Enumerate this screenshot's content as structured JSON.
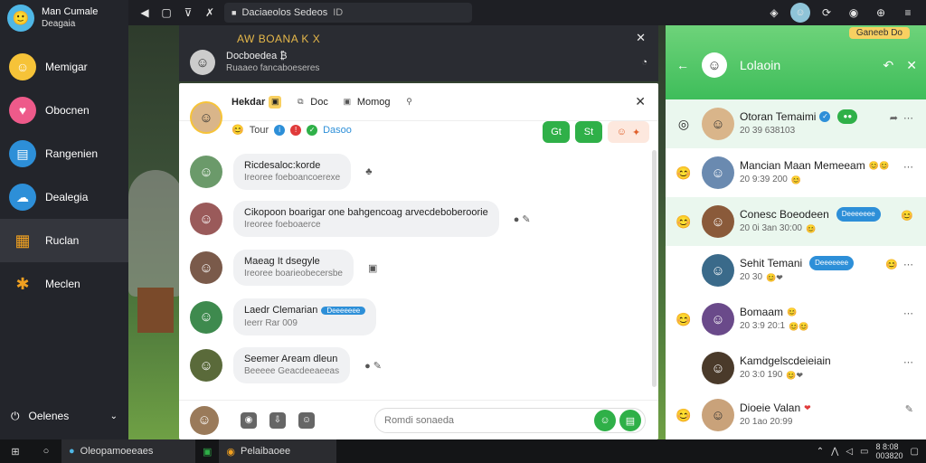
{
  "sidebar": {
    "profile": {
      "name": "Man Cumale",
      "status": "Deagaia"
    },
    "items": [
      {
        "label": "Memigar",
        "icon": "smile-icon",
        "color": "#f6c338"
      },
      {
        "label": "Obocnen",
        "icon": "heart-icon",
        "color": "#ee5a8a"
      },
      {
        "label": "Rangenien",
        "icon": "chat-icon",
        "color": "#2d8fd8"
      },
      {
        "label": "Dealegia",
        "icon": "cloud-icon",
        "color": "#2d8fd8"
      },
      {
        "label": "Ruclan",
        "icon": "grid-icon",
        "color": "#f0a020"
      },
      {
        "label": "Meclen",
        "icon": "star-icon",
        "color": "#f0a020"
      }
    ],
    "bottom_label": "Oelenes"
  },
  "topbar": {
    "address": "Daciaeolos Sedeos",
    "address_tag": "ID"
  },
  "notification": {
    "title": "AW BOANA K X",
    "text": "Docboedea ₿",
    "sub": "Ruaaeo fancaboeseres"
  },
  "chat": {
    "tabs": [
      "Hekdar",
      "Doc",
      "Momog"
    ],
    "header_status": "Tour",
    "header_extra": "Dasoo",
    "btn_green": "Gt",
    "btn_green2": "St",
    "messages": [
      {
        "title": "Ricdesaloc:korde",
        "sub": "Ireoree foeboancoerexe",
        "pill": ""
      },
      {
        "title": "Cikopoon boarigar one bahgencoag arvecdeboberoorie",
        "sub": "Ireoree foeboaerce",
        "pill": ""
      },
      {
        "title": "Maeag It dsegyle",
        "sub": "Ireoree boarieobecersbe",
        "pill": ""
      },
      {
        "title": "Laedr Clemarian",
        "sub": "Ieerr Rar 009",
        "pill": "Deeeeeee"
      },
      {
        "title": "Seemer Aream dleun",
        "sub": "Beeeee Geacdeeaeeas",
        "pill": ""
      }
    ],
    "composer_placeholder": "Romdi sonaeda"
  },
  "panel": {
    "badge": "Ganeeb Do",
    "title": "Lolaoin",
    "contacts": [
      {
        "name": "Otoran Temaimi",
        "sub": "20 39 638103",
        "tag": ""
      },
      {
        "name": "Mancian Maan Memeeam",
        "sub": "20 9:39 200",
        "tag": ""
      },
      {
        "name": "Conesc Boeodeen",
        "sub": "20 0i 3an 30:00",
        "tag": "Deeeeeee"
      },
      {
        "name": "Sehit Temani",
        "sub": "20 30",
        "tag": "Deeeeeee"
      },
      {
        "name": "Bomaam",
        "sub": "20 3:9 20:1",
        "tag": ""
      },
      {
        "name": "Kamdgelscdeieiain",
        "sub": "20 3:0 190",
        "tag": ""
      },
      {
        "name": "Dioeie Valan",
        "sub": "20 1ao 20:99",
        "tag": ""
      }
    ]
  },
  "taskbar": {
    "task1": "Oleopamoeeaes",
    "task2": "Pelaibaoee",
    "time": "8 8:08",
    "date": "003820"
  }
}
